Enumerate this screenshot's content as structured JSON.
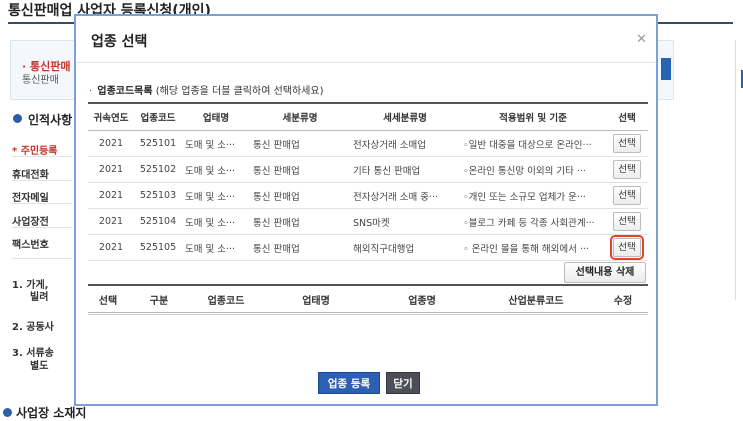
{
  "background": {
    "page_title": "통신판매업 사업자 등록신청(개인)",
    "info_line1": "· 통신판매",
    "info_line2": "통신판매",
    "section_person": "인적사항",
    "rows": [
      "* 주민등록",
      "휴대전화",
      "전자메일",
      "사업장전",
      "팩스번호"
    ],
    "items": [
      "1. 가게,",
      "빌려",
      "2. 공동사",
      "3. 서류송",
      "별도 "
    ],
    "section_business": "사업장 소재지"
  },
  "modal": {
    "title": "업종 선택",
    "close_icon": "close-icon",
    "list_caption_main": "업종코드목록",
    "list_caption_hint": "(해당 업종을 더블 클릭하여 선택하세요)",
    "table": {
      "headers": [
        "귀속연도",
        "업종코드",
        "업태명",
        "세분류명",
        "세세분류명",
        "적용범위 및 기준",
        "선택"
      ],
      "rows": [
        {
          "year": "2021",
          "code": "525101",
          "type": "도매 및 소···",
          "sub": "통신 판매업",
          "subsub": "전자상거래 소매업",
          "scope": "◦일반 대중을 대상으로 온라인···",
          "select": "선택"
        },
        {
          "year": "2021",
          "code": "525102",
          "type": "도매 및 소···",
          "sub": "통신 판매업",
          "subsub": "기타 통신 판매업",
          "scope": "◦온라인 통신망 이외의 기타 ···",
          "select": "선택"
        },
        {
          "year": "2021",
          "code": "525103",
          "type": "도매 및 소···",
          "sub": "통신 판매업",
          "subsub": "전자상거래 소매 중···",
          "scope": "◦개인 또는 소규모 업체가 운···",
          "select": "선택"
        },
        {
          "year": "2021",
          "code": "525104",
          "type": "도매 및 소···",
          "sub": "통신 판매업",
          "subsub": "SNS마켓",
          "scope": "◦블로그 카페 등 각종 사회관계···",
          "select": "선택"
        },
        {
          "year": "2021",
          "code": "525105",
          "type": "도매 및 소···",
          "sub": "통신 판매업",
          "subsub": "해외직구대행업",
          "scope": "◦ 온라인 몰을 통해 해외에서 ···",
          "select": "선택"
        }
      ]
    },
    "delete_label": "선택내용 삭제",
    "chosen_headers": [
      "선택",
      "구분",
      "업종코드",
      "업태명",
      "업종명",
      "산업분류코드",
      "수정"
    ],
    "register_label": "업종 등록",
    "close_label": "닫기",
    "highlight_color": "#e0442a",
    "primary_color": "#2d5fb3"
  }
}
